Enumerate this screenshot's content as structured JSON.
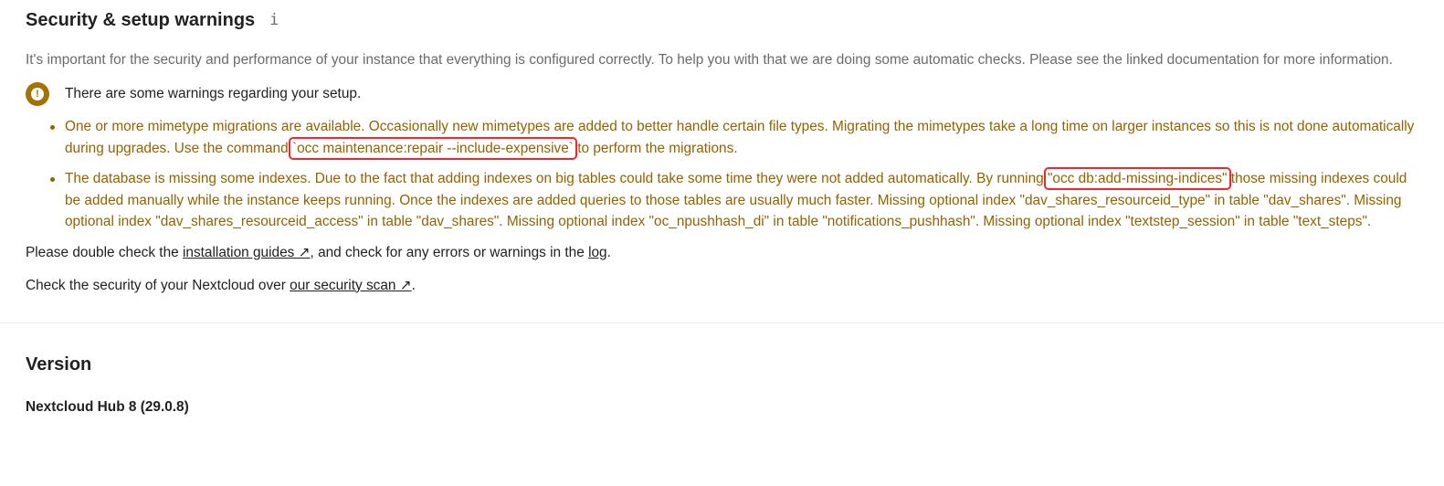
{
  "security": {
    "title": "Security & setup warnings",
    "info_icon": "i",
    "description": "It's important for the security and performance of your instance that everything is configured correctly. To help you with that we are doing some automatic checks. Please see the linked documentation for more information.",
    "warning_heading": "There are some warnings regarding your setup.",
    "warnings": [
      {
        "before": "One or more mimetype migrations are available. Occasionally new mimetypes are added to better handle certain file types. Migrating the mimetypes take a long time on larger instances so this is not done automatically during upgrades. Use the command ",
        "command": "`occ maintenance:repair --include-expensive`",
        "after": " to perform the migrations."
      },
      {
        "before": "The database is missing some indexes. Due to the fact that adding indexes on big tables could take some time they were not added automatically. By running ",
        "command": "\"occ db:add-missing-indices\"",
        "after": " those missing indexes could be added manually while the instance keeps running. Once the indexes are added queries to those tables are usually much faster. Missing optional index \"dav_shares_resourceid_type\" in table \"dav_shares\". Missing optional index \"dav_shares_resourceid_access\" in table \"dav_shares\". Missing optional index \"oc_npushhash_di\" in table \"notifications_pushhash\". Missing optional index \"textstep_session\" in table \"text_steps\"."
      }
    ],
    "double_check": {
      "prefix": "Please double check the ",
      "guides_link": "installation guides ↗",
      "middle": ", and check for any errors or warnings in the ",
      "log_link": "log",
      "suffix": "."
    },
    "scan": {
      "prefix": "Check the security of your Nextcloud over ",
      "scan_link": "our security scan ↗",
      "suffix": "."
    }
  },
  "version": {
    "title": "Version",
    "value": "Nextcloud Hub 8 (29.0.8)"
  },
  "colors": {
    "warning": "#946300",
    "warning_icon": "#a37200",
    "highlight_box": "#f0282d"
  }
}
